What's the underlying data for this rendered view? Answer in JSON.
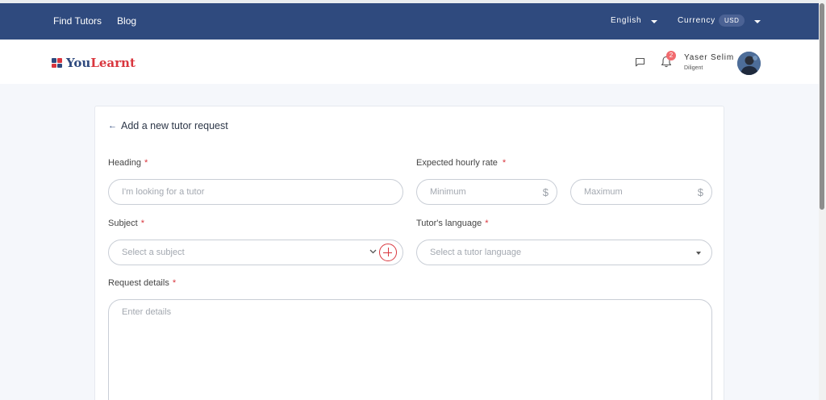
{
  "topbar": {
    "nav": [
      "Find Tutors",
      "Blog"
    ],
    "language": "English",
    "currency_label": "Currency",
    "currency_value": "USD"
  },
  "header": {
    "logo_you": "You",
    "logo_learnt": "Learnt",
    "notification_count": "2",
    "user_name": "Yaser Selim",
    "user_level": "Diligent"
  },
  "form": {
    "back_label": "Add a new tutor request",
    "heading": {
      "label": "Heading",
      "required": "*",
      "placeholder": "I'm looking for a tutor"
    },
    "rate": {
      "label": "Expected hourly rate",
      "required": "*",
      "min_placeholder": "Minimum",
      "max_placeholder": "Maximum",
      "currency_symbol": "$"
    },
    "subject": {
      "label": "Subject",
      "required": "*",
      "placeholder": "Select a subject"
    },
    "language": {
      "label": "Tutor's language",
      "required": "*",
      "placeholder": "Select a tutor language"
    },
    "details": {
      "label": "Request details",
      "required": "*",
      "placeholder": "Enter details"
    }
  },
  "colors": {
    "topbar_bg": "#2f4a7e",
    "accent_red": "#d9363e",
    "badge_red": "#f16b6f",
    "logo_blue": "#2f4a7e",
    "logo_red": "#d9363e"
  },
  "icons": [
    "message-icon",
    "bell-icon",
    "back-arrow-icon",
    "dollar-icon",
    "chevron-down-icon",
    "plus-circle-icon",
    "caret-down-icon"
  ]
}
